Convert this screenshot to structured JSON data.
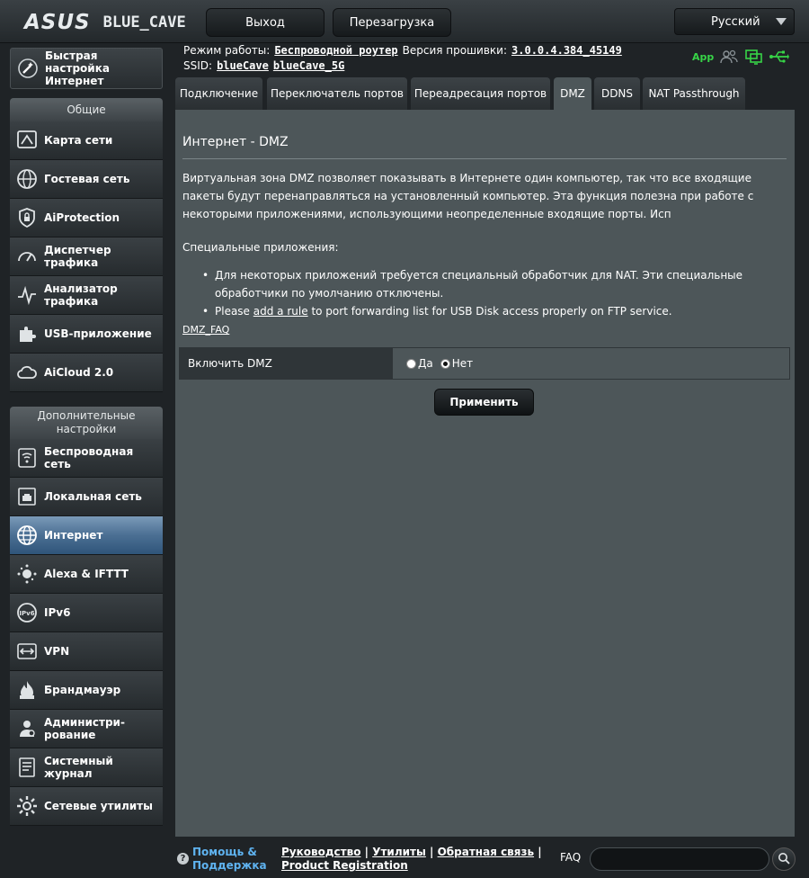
{
  "header": {
    "logo": "ASUS",
    "model": "BLUE_CAVE",
    "logout_label": "Выход",
    "reboot_label": "Перезагрузка",
    "language": "Русский"
  },
  "status": {
    "mode_label": "Режим работы:",
    "mode_value": "Беспроводной роутер",
    "firmware_label": "Версия прошивки:",
    "firmware_value": "3.0.0.4.384_45149",
    "ssid_label": "SSID:",
    "ssid_1": "blueCave",
    "ssid_2": "blueCave_5G",
    "app_label": "App"
  },
  "sidebar": {
    "quick_setup": "Быстрая настройка Интернет",
    "general_head": "Общие",
    "general_items": [
      {
        "label": "Карта сети",
        "icon": "network-map-icon"
      },
      {
        "label": "Гостевая сеть",
        "icon": "globe-icon"
      },
      {
        "label": "AiProtection",
        "icon": "shield-icon"
      },
      {
        "label": "Диспетчер трафика",
        "icon": "gauge-icon"
      },
      {
        "label": "Анализатор трафика",
        "icon": "analyzer-icon"
      },
      {
        "label": "USB-приложение",
        "icon": "puzzle-icon"
      },
      {
        "label": "AiCloud 2.0",
        "icon": "cloud-icon"
      }
    ],
    "advanced_head": "Дополнительные настройки",
    "advanced_items": [
      {
        "label": "Беспроводная сеть",
        "icon": "wifi-icon"
      },
      {
        "label": "Локальная сеть",
        "icon": "lan-icon"
      },
      {
        "label": "Интернет",
        "icon": "globe-icon"
      },
      {
        "label": "Alexa & IFTTT",
        "icon": "alexa-icon"
      },
      {
        "label": "IPv6",
        "icon": "ipv6-icon"
      },
      {
        "label": "VPN",
        "icon": "vpn-icon"
      },
      {
        "label": "Брандмауэр",
        "icon": "fire-icon"
      },
      {
        "label": "Администри-рование",
        "icon": "admin-icon"
      },
      {
        "label": "Системный журнал",
        "icon": "log-icon"
      },
      {
        "label": "Сетевые утилиты",
        "icon": "tools-icon"
      }
    ]
  },
  "tabs": [
    "Подключение",
    "Переключатель портов",
    "Переадресация портов",
    "DMZ",
    "DDNS",
    "NAT Passthrough"
  ],
  "main": {
    "title": "Интернет - DMZ",
    "description": "Виртуальная зона DMZ позволяет показывать в Интернете один компьютер, так что все входящие пакеты будут перенаправляться на установленный компьютер. Эта функция полезна при работе с некоторыми приложениями, использующими неопределенные входящие порты. Исп",
    "special_head": "Специальные приложения:",
    "bullet_1": "Для некоторых приложений требуется специальный обработчик для NAT. Эти специальные обработчики по умолчанию отключены.",
    "bullet_2_pre": "Please",
    "bullet_2_link": "add a rule",
    "bullet_2_post": "to port forwarding list for USB Disk access properly on FTP service.",
    "faq_link": "DMZ_FAQ",
    "enable_label": "Включить DMZ",
    "opt_yes": "Да",
    "opt_no": "Нет",
    "selected": "Нет",
    "apply_label": "Применить"
  },
  "footer": {
    "help": "Помощь & Поддержка",
    "links": [
      "Руководство",
      "Утилиты",
      "Обратная связь",
      "Product Registration"
    ],
    "faq_label": "FAQ"
  },
  "colors": {
    "panel": "#4d5659",
    "active_nav": "#4b6f93",
    "help_link": "#5fb3f0",
    "status_green": "#37d447"
  }
}
